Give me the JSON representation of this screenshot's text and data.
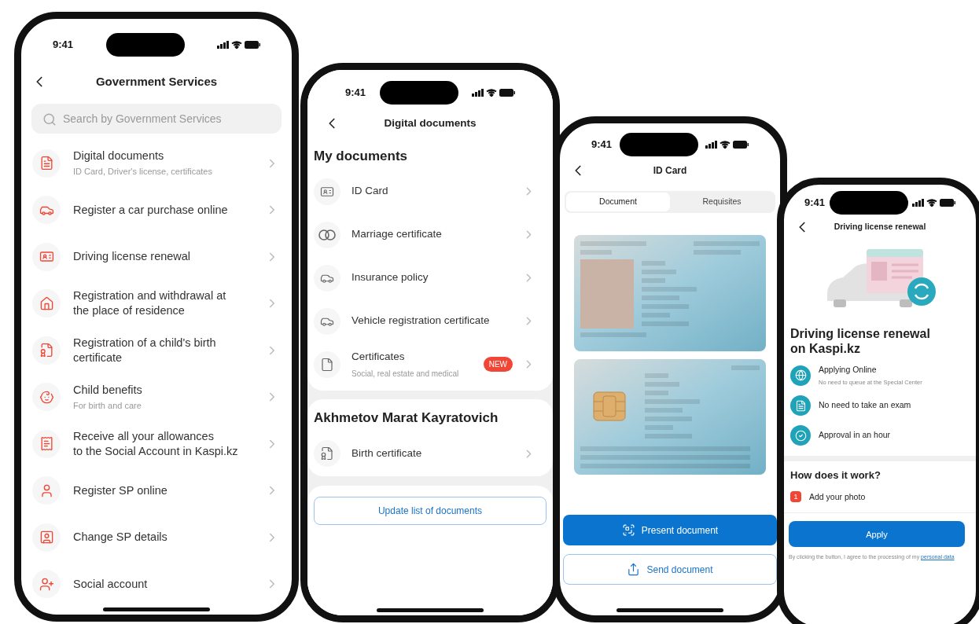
{
  "services_screen": {
    "status_time": "9:41",
    "title": "Government Services",
    "search": {
      "placeholder": "Search by Government Services"
    },
    "items": [
      {
        "title": "Digital documents",
        "subtitle": "ID Card, Driver's license, certificates"
      },
      {
        "title": "Register a car purchase online"
      },
      {
        "title": "Driving license renewal"
      },
      {
        "title": "Registration and withdrawal at\nthe place of residence"
      },
      {
        "title": "Registration of a child's birth\ncertificate"
      },
      {
        "title": "Child benefits",
        "subtitle": "For birth and care"
      },
      {
        "title": "Receive all your allowances\nto the Social Account in Kaspi.kz"
      },
      {
        "title": "Register SP online"
      },
      {
        "title": "Change SP details"
      },
      {
        "title": "Social account"
      }
    ]
  },
  "documents_screen": {
    "status_time": "9:41",
    "title": "Digital documents",
    "sections": [
      {
        "heading": "My documents",
        "items": [
          {
            "title": "ID Card"
          },
          {
            "title": "Marriage certificate"
          },
          {
            "title": "Insurance policy"
          },
          {
            "title": "Vehicle registration certificate"
          },
          {
            "title": "Certificates",
            "subtitle": "Social, real estate and medical",
            "badge": "NEW"
          }
        ]
      },
      {
        "heading": "Akhmetov Marat Kayratovich",
        "items": [
          {
            "title": "Birth certificate"
          }
        ]
      }
    ],
    "update_button": "Update list of documents"
  },
  "id_card_screen": {
    "status_time": "9:41",
    "title": "ID Card",
    "tabs": [
      {
        "label": "Document",
        "selected": true
      },
      {
        "label": "Requisites",
        "selected": false
      }
    ],
    "buttons": [
      {
        "label": "Present document",
        "kind": "primary"
      },
      {
        "label": "Send document",
        "kind": "secondary"
      }
    ]
  },
  "license_screen": {
    "status_time": "9:41",
    "title": "Driving license renewal",
    "heading": "Driving license renewal\non Kaspi.kz",
    "features": [
      {
        "title": "Applying Online",
        "subtitle": "No need to queue at the Special Center"
      },
      {
        "title": "No need to take an exam"
      },
      {
        "title": "Approval in an hour"
      }
    ],
    "how_heading": "How does it work?",
    "steps": [
      {
        "number": "1",
        "text": "Add your photo"
      }
    ],
    "apply_button": "Apply",
    "consent": {
      "text": "By clicking the button, I agree to the processing of my",
      "link": "personal data"
    }
  }
}
